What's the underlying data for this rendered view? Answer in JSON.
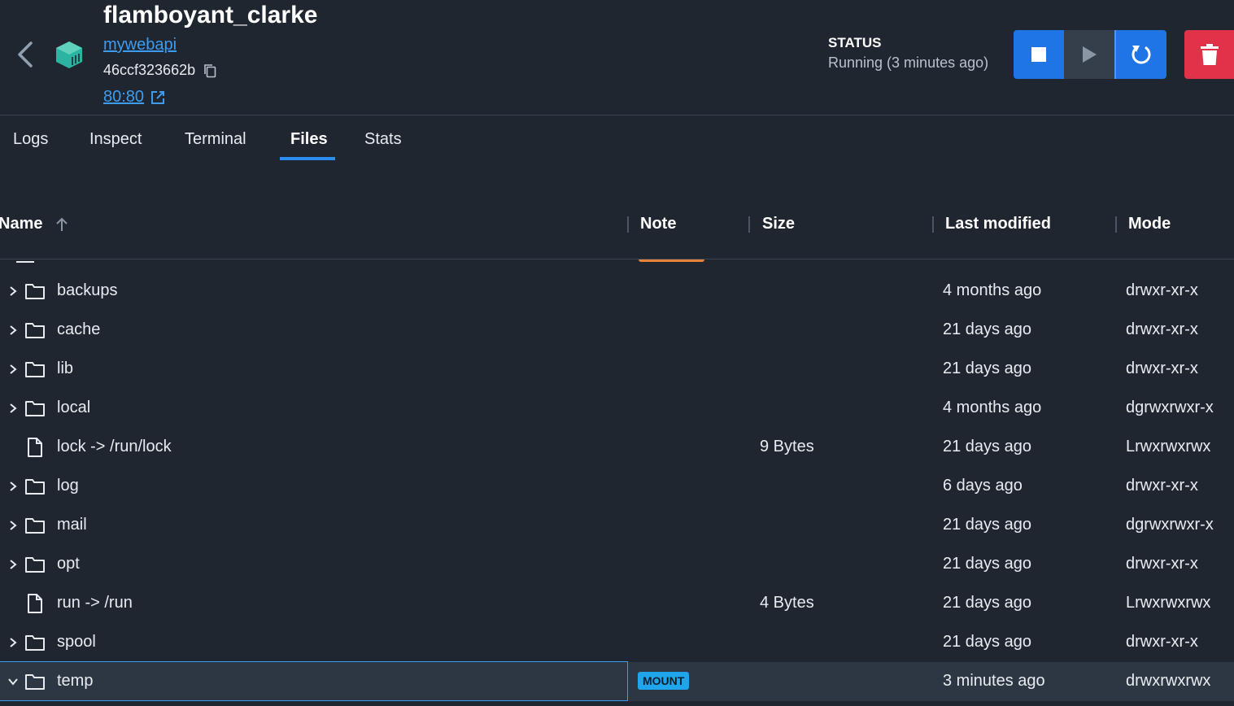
{
  "container": {
    "name": "flamboyant_clarke",
    "image": "mywebapi",
    "id": "46ccf323662b",
    "port": "80:80"
  },
  "status": {
    "label": "STATUS",
    "value": "Running (3 minutes ago)"
  },
  "colors": {
    "accent": "#1f74e6",
    "danger": "#e0334a",
    "mount_badge": "#1fa5ec",
    "container_icon": "#2bb5a0"
  },
  "tabs": [
    {
      "label": "Logs"
    },
    {
      "label": "Inspect"
    },
    {
      "label": "Terminal"
    },
    {
      "label": "Files",
      "active": true
    },
    {
      "label": "Stats"
    }
  ],
  "table": {
    "columns": {
      "name": "Name",
      "note": "Note",
      "size": "Size",
      "modified": "Last modified",
      "mode": "Mode"
    },
    "rows": [
      {
        "name": "backups",
        "type": "folder",
        "note": "",
        "size": "",
        "modified": "4 months ago",
        "mode": "drwxr-xr-x"
      },
      {
        "name": "cache",
        "type": "folder",
        "note": "",
        "size": "",
        "modified": "21 days ago",
        "mode": "drwxr-xr-x"
      },
      {
        "name": "lib",
        "type": "folder",
        "note": "",
        "size": "",
        "modified": "21 days ago",
        "mode": "drwxr-xr-x"
      },
      {
        "name": "local",
        "type": "folder",
        "note": "",
        "size": "",
        "modified": "4 months ago",
        "mode": "dgrwxrwxr-x"
      },
      {
        "name": "lock -> /run/lock",
        "type": "file",
        "note": "",
        "size": "9 Bytes",
        "modified": "21 days ago",
        "mode": "Lrwxrwxrwx"
      },
      {
        "name": "log",
        "type": "folder",
        "note": "",
        "size": "",
        "modified": "6 days ago",
        "mode": "drwxr-xr-x"
      },
      {
        "name": "mail",
        "type": "folder",
        "note": "",
        "size": "",
        "modified": "21 days ago",
        "mode": "dgrwxrwxr-x"
      },
      {
        "name": "opt",
        "type": "folder",
        "note": "",
        "size": "",
        "modified": "21 days ago",
        "mode": "drwxr-xr-x"
      },
      {
        "name": "run -> /run",
        "type": "file",
        "note": "",
        "size": "4 Bytes",
        "modified": "21 days ago",
        "mode": "Lrwxrwxrwx"
      },
      {
        "name": "spool",
        "type": "folder",
        "note": "",
        "size": "",
        "modified": "21 days ago",
        "mode": "drwxr-xr-x"
      },
      {
        "name": "temp",
        "type": "folder",
        "expanded": true,
        "selected": true,
        "note": "MOUNT",
        "size": "",
        "modified": "3 minutes ago",
        "mode": "drwxrwxrwx"
      }
    ]
  }
}
